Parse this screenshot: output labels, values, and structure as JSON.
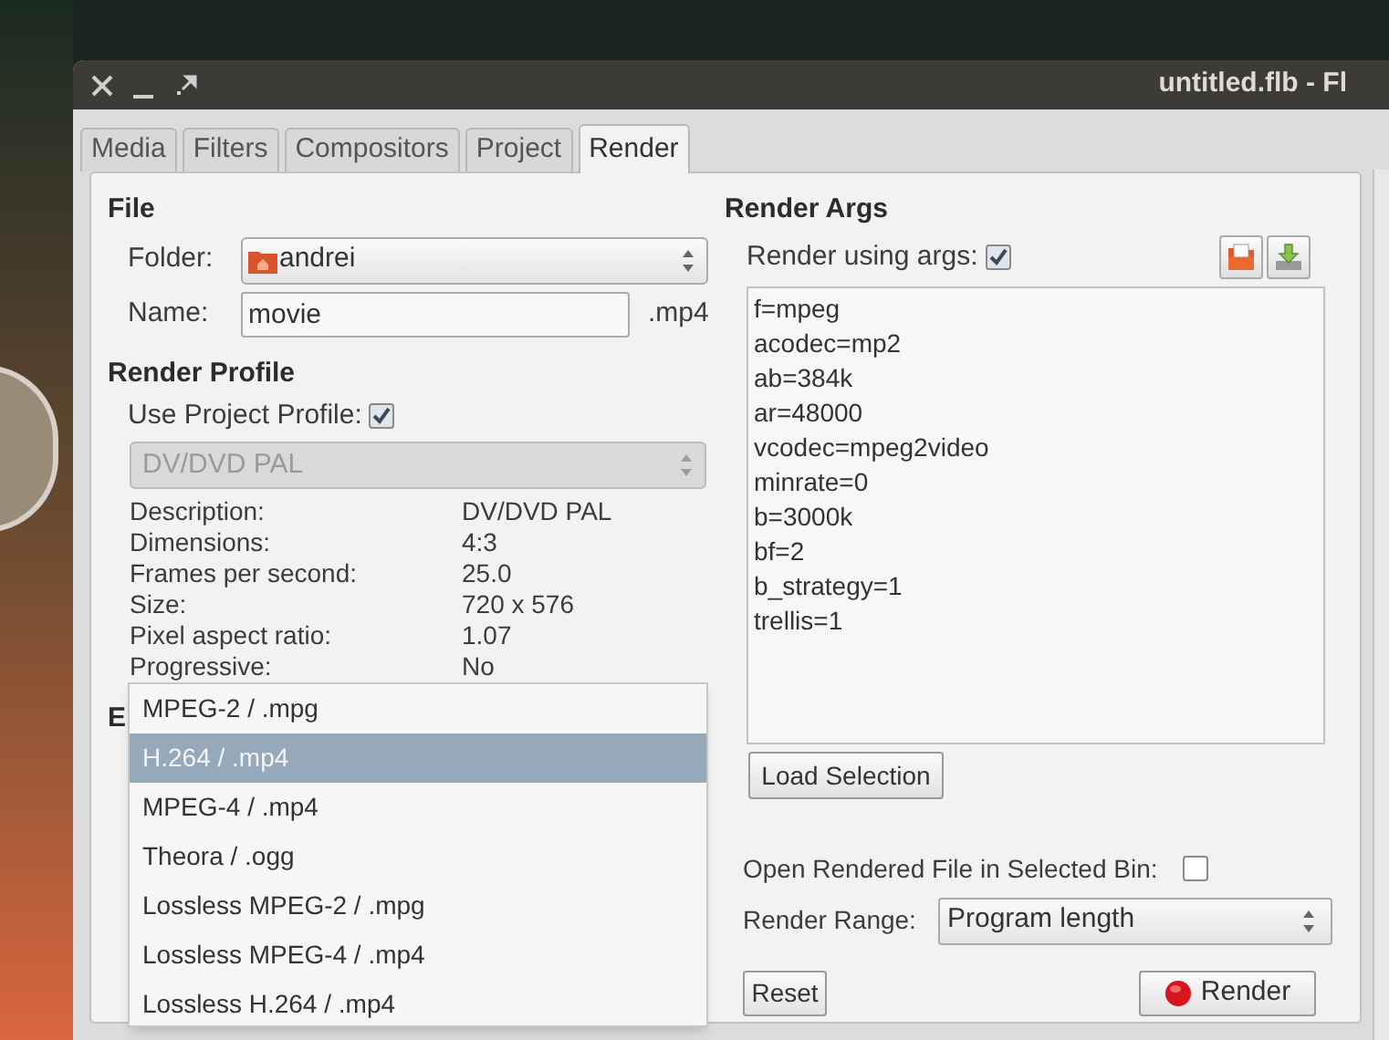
{
  "window": {
    "title": "untitled.flb - Fl"
  },
  "tabs": [
    {
      "label": "Media",
      "selected": false
    },
    {
      "label": "Filters",
      "selected": false
    },
    {
      "label": "Compositors",
      "selected": false
    },
    {
      "label": "Project",
      "selected": false
    },
    {
      "label": "Render",
      "selected": true
    }
  ],
  "file": {
    "heading": "File",
    "folder_label": "Folder:",
    "folder": "andrei",
    "name_label": "Name:",
    "name": "movie",
    "extension": ".mp4"
  },
  "render_profile": {
    "heading": "Render Profile",
    "use_project_profile": {
      "label": "Use Project Profile:",
      "checked": true
    },
    "profile": {
      "value": "DV/DVD PAL",
      "disabled": true
    },
    "info": [
      {
        "label": "Description:",
        "value": "DV/DVD PAL"
      },
      {
        "label": "Dimensions:",
        "value": "4:3"
      },
      {
        "label": "Frames per second:",
        "value": "25.0"
      },
      {
        "label": "Size:",
        "value": "720 x 576"
      },
      {
        "label": "Pixel aspect ratio:",
        "value": "1.07"
      },
      {
        "label": "Progressive:",
        "value": "No"
      }
    ]
  },
  "encoding": {
    "label": "E",
    "options": [
      {
        "label": "MPEG-2 / .mpg",
        "selected": false
      },
      {
        "label": "H.264 / .mp4",
        "selected": true
      },
      {
        "label": "MPEG-4 / .mp4",
        "selected": false
      },
      {
        "label": "Theora / .ogg",
        "selected": false
      },
      {
        "label": "Lossless MPEG-2 / .mpg",
        "selected": false
      },
      {
        "label": "Lossless MPEG-4 / .mp4",
        "selected": false
      },
      {
        "label": "Lossless H.264 / .mp4",
        "selected": false
      }
    ]
  },
  "render_args": {
    "heading": "Render Args",
    "use_args": {
      "label": "Render using args:",
      "checked": true
    },
    "args": [
      "f=mpeg",
      "acodec=mp2",
      "ab=384k",
      "ar=48000",
      "vcodec=mpeg2video",
      "minrate=0",
      "b=3000k",
      "bf=2",
      "b_strategy=1",
      "trellis=1"
    ],
    "load_button": "Load Selection"
  },
  "open_in_bin": {
    "label": "Open Rendered File in Selected Bin:",
    "checked": false
  },
  "render_range": {
    "label": "Render Range:",
    "value": "Program length"
  },
  "buttons": {
    "reset": "Reset",
    "render": "Render"
  }
}
